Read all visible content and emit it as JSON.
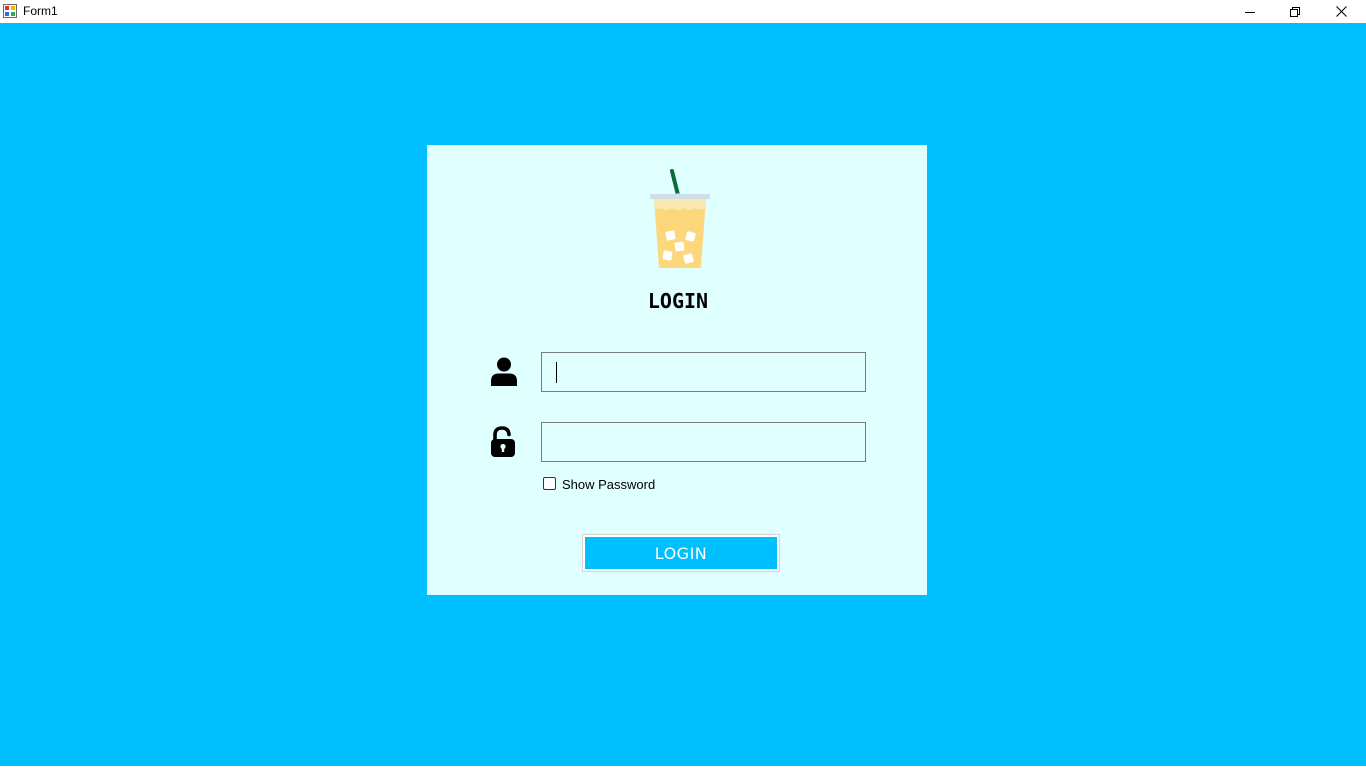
{
  "window": {
    "title": "Form1",
    "buttons": [
      "minimize",
      "restore",
      "close"
    ]
  },
  "colors": {
    "background": "#00BFFF",
    "panel": "#E0FFFF",
    "button": "#00BFFF",
    "button_text": "#FFFFFF"
  },
  "login": {
    "logo_icon": "iced-drink-icon",
    "heading": "LOGIN",
    "username_icon": "user-icon",
    "username_value": "",
    "password_icon": "unlock-icon",
    "password_value": "",
    "show_password_label": "Show Password",
    "show_password_checked": false,
    "button_label": "LOGIN"
  }
}
